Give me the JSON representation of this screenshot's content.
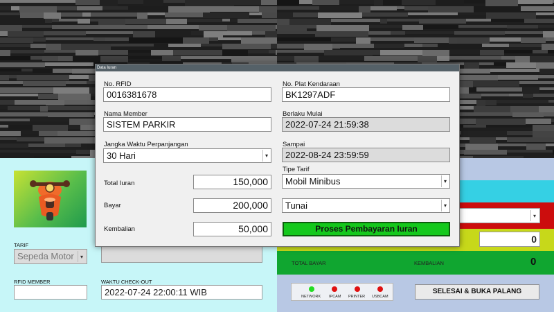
{
  "dialog": {
    "title": "Data Iuran",
    "rfid_label": "No. RFID",
    "rfid_value": "0016381678",
    "plat_label": "No. Plat Kendaraan",
    "plat_value": "BK1297ADF",
    "member_label": "Nama Member",
    "member_value": "SISTEM PARKIR",
    "berlaku_label": "Berlaku Mulai",
    "berlaku_value": "2022-07-24 21:59:38",
    "jangka_label": "Jangka Waktu Perpanjangan",
    "jangka_value": "30 Hari",
    "sampai_label": "Sampai",
    "sampai_value": "2022-08-24 23:59:59",
    "tipe_label": "Tipe Tarif",
    "tipe_value": "Mobil Minibus",
    "total_label": "Total Iuran",
    "total_value": "150,000",
    "bayar_label": "Bayar",
    "bayar_value": "200,000",
    "metode_value": "Tunai",
    "kembalian_label": "Kembalian",
    "kembalian_value": "50,000",
    "proses_label": "Proses Pembayaran Iuran"
  },
  "left_panel": {
    "tarif_label": "TARIF",
    "tarif_value": "Sepeda Motor",
    "rfid_member_label": "RFID MEMBER",
    "checkout_label": "WAKTU CHECK-OUT",
    "checkout_value": "2022-07-24 22:00:11 WIB"
  },
  "right_panel": {
    "yellow_value": "0",
    "total_bayar_label": "TOTAL BAYAR",
    "kembalian_label": "KEMBALIAN",
    "kembalian_value": "0",
    "status": [
      {
        "label": "NETWORK",
        "color": "#22dd22"
      },
      {
        "label": "IPCAM",
        "color": "#e01010"
      },
      {
        "label": "PRINTER",
        "color": "#e01010"
      },
      {
        "label": "USBCAM",
        "color": "#e01010"
      }
    ],
    "selesai_label": "SELESAI & BUKA PALANG"
  },
  "icons": {
    "vehicle": "scooter-icon"
  }
}
